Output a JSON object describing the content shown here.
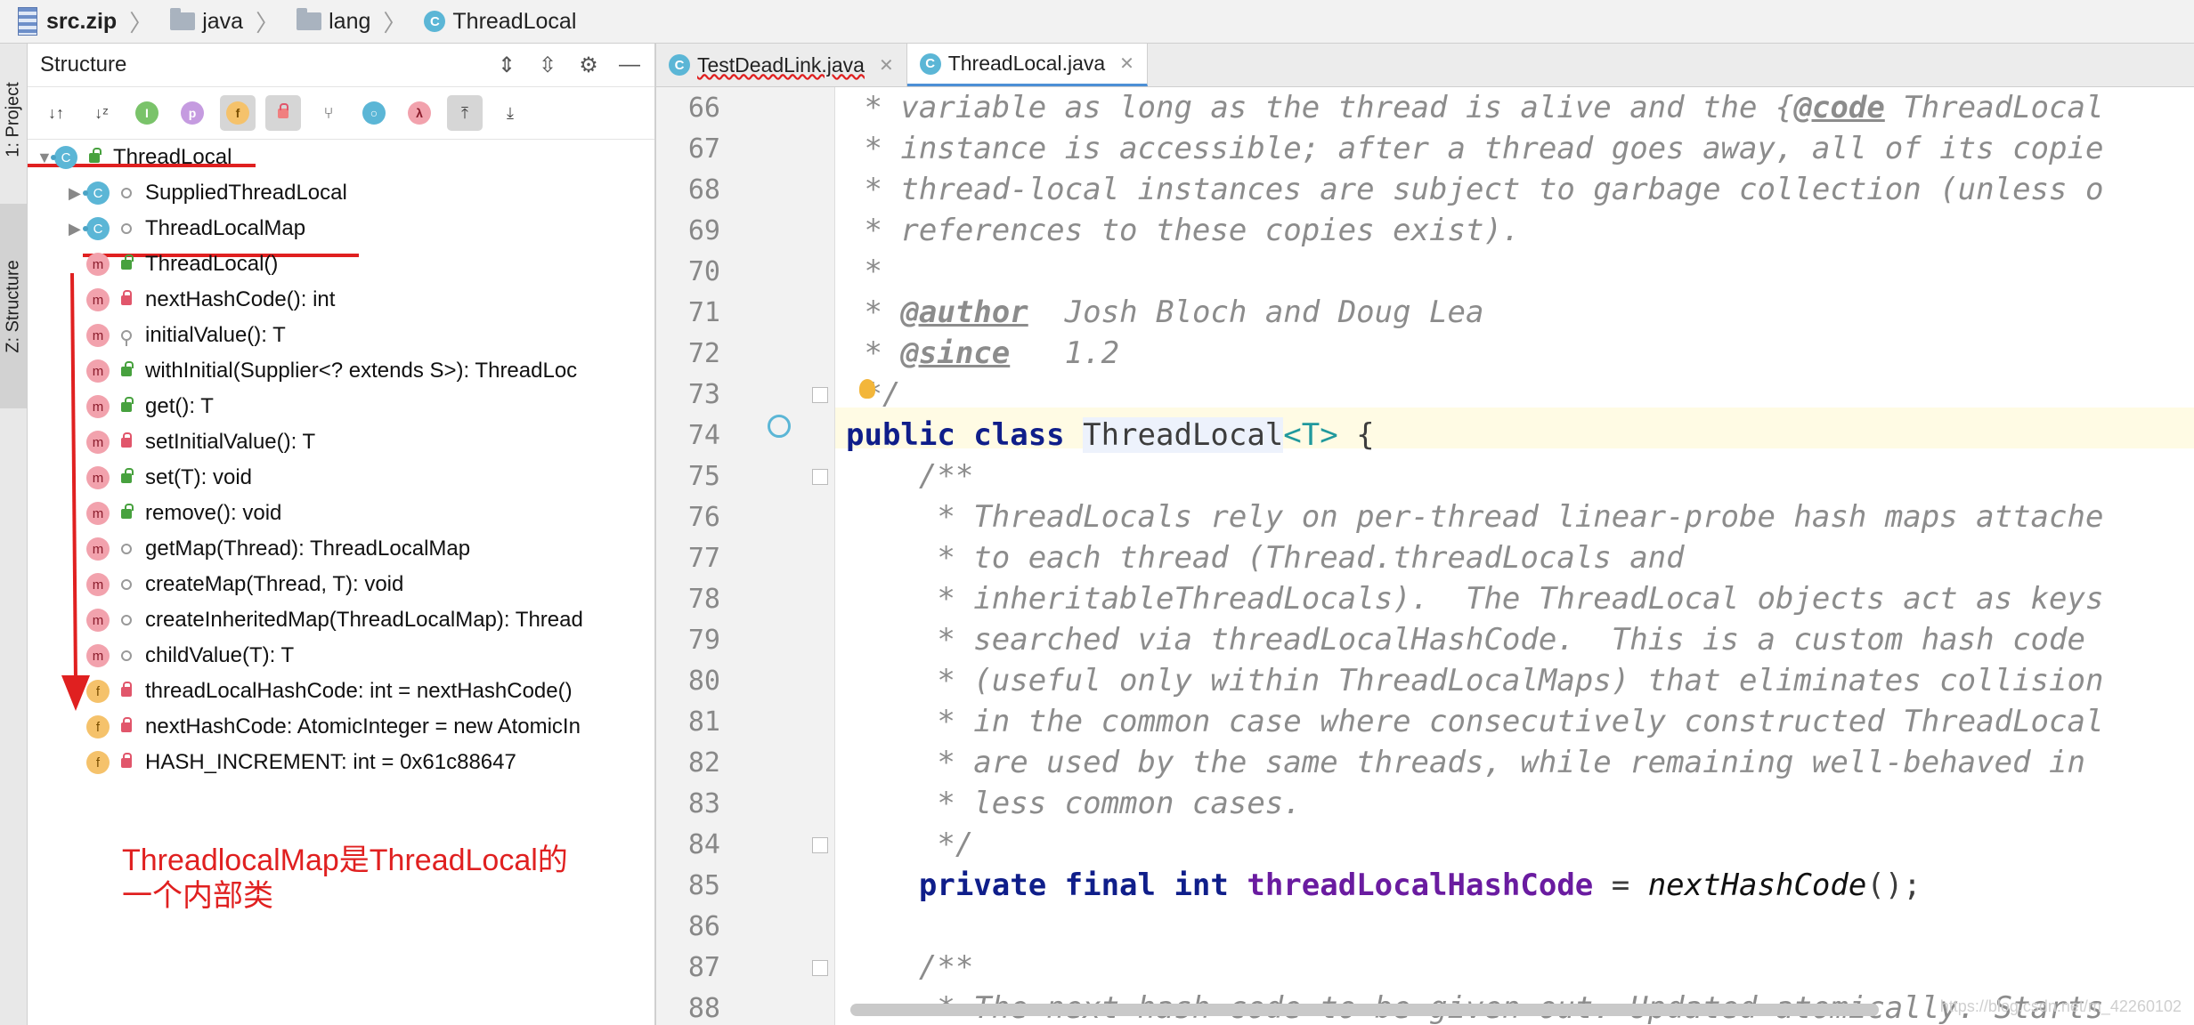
{
  "breadcrumb": [
    "src.zip",
    "java",
    "lang",
    "ThreadLocal"
  ],
  "side_tabs": {
    "project": "1: Project",
    "structure": "Z: Structure"
  },
  "structure": {
    "title": "Structure",
    "tree": [
      {
        "label": "ThreadLocal",
        "kind": "c",
        "vis": "public",
        "indent": 0,
        "arrow": "▼"
      },
      {
        "label": "SuppliedThreadLocal",
        "kind": "c",
        "vis": "package",
        "indent": 1,
        "arrow": "▶"
      },
      {
        "label": "ThreadLocalMap",
        "kind": "c",
        "vis": "package",
        "indent": 1,
        "arrow": "▶"
      },
      {
        "label": "ThreadLocal()",
        "kind": "m",
        "vis": "public",
        "indent": 1
      },
      {
        "label": "nextHashCode(): int",
        "kind": "m",
        "vis": "private",
        "indent": 1
      },
      {
        "label": "initialValue(): T",
        "kind": "m",
        "vis": "protected",
        "indent": 1
      },
      {
        "label": "withInitial(Supplier<? extends S>): ThreadLoc",
        "kind": "m",
        "vis": "public",
        "indent": 1
      },
      {
        "label": "get(): T",
        "kind": "m",
        "vis": "public",
        "indent": 1
      },
      {
        "label": "setInitialValue(): T",
        "kind": "m",
        "vis": "private",
        "indent": 1
      },
      {
        "label": "set(T): void",
        "kind": "m",
        "vis": "public",
        "indent": 1
      },
      {
        "label": "remove(): void",
        "kind": "m",
        "vis": "public",
        "indent": 1
      },
      {
        "label": "getMap(Thread): ThreadLocalMap",
        "kind": "m",
        "vis": "package",
        "indent": 1
      },
      {
        "label": "createMap(Thread, T): void",
        "kind": "m",
        "vis": "package",
        "indent": 1
      },
      {
        "label": "createInheritedMap(ThreadLocalMap): Thread",
        "kind": "m",
        "vis": "package",
        "indent": 1
      },
      {
        "label": "childValue(T): T",
        "kind": "m",
        "vis": "package",
        "indent": 1
      },
      {
        "label": "threadLocalHashCode: int = nextHashCode()",
        "kind": "f",
        "vis": "private",
        "indent": 1
      },
      {
        "label": "nextHashCode: AtomicInteger = new AtomicIn",
        "kind": "f",
        "vis": "private",
        "indent": 1
      },
      {
        "label": "HASH_INCREMENT: int = 0x61c88647",
        "kind": "f",
        "vis": "private",
        "indent": 1
      }
    ]
  },
  "annotation": {
    "line1": "ThreadlocalMap是ThreadLocal的",
    "line2": "一个内部类"
  },
  "tabs": [
    {
      "label": "TestDeadLink.java",
      "active": false
    },
    {
      "label": "ThreadLocal.java",
      "active": true
    }
  ],
  "code": [
    {
      "n": "66",
      "s": [
        {
          "t": " * variable as long as the thread is alive and the {",
          "c": "cm"
        },
        {
          "t": "@code",
          "c": "tag"
        },
        {
          "t": " ThreadLocal",
          "c": "cm"
        }
      ]
    },
    {
      "n": "67",
      "s": [
        {
          "t": " * instance is accessible; after a thread goes away, all of its copie",
          "c": "cm"
        }
      ]
    },
    {
      "n": "68",
      "s": [
        {
          "t": " * thread-local instances are subject to garbage collection (unless o",
          "c": "cm"
        }
      ]
    },
    {
      "n": "69",
      "s": [
        {
          "t": " * references to these copies exist).",
          "c": "cm"
        }
      ]
    },
    {
      "n": "70",
      "s": [
        {
          "t": " *",
          "c": "cm"
        }
      ]
    },
    {
      "n": "71",
      "s": [
        {
          "t": " * ",
          "c": "cm"
        },
        {
          "t": "@author",
          "c": "tag"
        },
        {
          "t": "  Josh Bloch and Doug Lea",
          "c": "cm"
        }
      ]
    },
    {
      "n": "72",
      "s": [
        {
          "t": " * ",
          "c": "cm"
        },
        {
          "t": "@since",
          "c": "tag"
        },
        {
          "t": "   1.2",
          "c": "cm"
        }
      ]
    },
    {
      "n": "73",
      "s": [
        {
          "t": " */",
          "c": "cm"
        }
      ]
    },
    {
      "n": "74",
      "s": [
        {
          "t": "public class ",
          "c": "kw"
        },
        {
          "t": "ThreadLocal",
          "c": "cur"
        },
        {
          "t": "<T>",
          "c": "tp"
        },
        {
          "t": " {",
          "c": ""
        }
      ]
    },
    {
      "n": "75",
      "s": [
        {
          "t": "    /**",
          "c": "cm"
        }
      ]
    },
    {
      "n": "76",
      "s": [
        {
          "t": "     * ThreadLocals rely on per-thread linear-probe hash maps attache",
          "c": "cm"
        }
      ]
    },
    {
      "n": "77",
      "s": [
        {
          "t": "     * to each thread (Thread.threadLocals and",
          "c": "cm"
        }
      ]
    },
    {
      "n": "78",
      "s": [
        {
          "t": "     * inheritableThreadLocals).  The ThreadLocal objects act as keys",
          "c": "cm"
        }
      ]
    },
    {
      "n": "79",
      "s": [
        {
          "t": "     * searched via threadLocalHashCode.  This is a custom hash code",
          "c": "cm"
        }
      ]
    },
    {
      "n": "80",
      "s": [
        {
          "t": "     * (useful only within ThreadLocalMaps) that eliminates collision",
          "c": "cm"
        }
      ]
    },
    {
      "n": "81",
      "s": [
        {
          "t": "     * in the common case where consecutively constructed ThreadLocal",
          "c": "cm"
        }
      ]
    },
    {
      "n": "82",
      "s": [
        {
          "t": "     * are used by the same threads, while remaining well-behaved in",
          "c": "cm"
        }
      ]
    },
    {
      "n": "83",
      "s": [
        {
          "t": "     * less common cases.",
          "c": "cm"
        }
      ]
    },
    {
      "n": "84",
      "s": [
        {
          "t": "     */",
          "c": "cm"
        }
      ]
    },
    {
      "n": "85",
      "s": [
        {
          "t": "    private final int ",
          "c": "kw"
        },
        {
          "t": "threadLocalHashCode",
          "c": "fld"
        },
        {
          "t": " = ",
          "c": ""
        },
        {
          "t": "nextHashCode",
          "c": "call"
        },
        {
          "t": "();",
          "c": ""
        }
      ]
    },
    {
      "n": "86",
      "s": []
    },
    {
      "n": "87",
      "s": [
        {
          "t": "    /**",
          "c": "cm"
        }
      ]
    },
    {
      "n": "88",
      "s": [
        {
          "t": "     * The next hash code to be given out. Updated atomically. Starts",
          "c": "cm"
        }
      ]
    }
  ],
  "watermark": "https://blog.csdn.net/m_42260102",
  "colors": {
    "accent": "#4c8fd6",
    "annotation": "#e02020",
    "keyword": "#0f1e8a",
    "comment": "#8c8c8c"
  }
}
